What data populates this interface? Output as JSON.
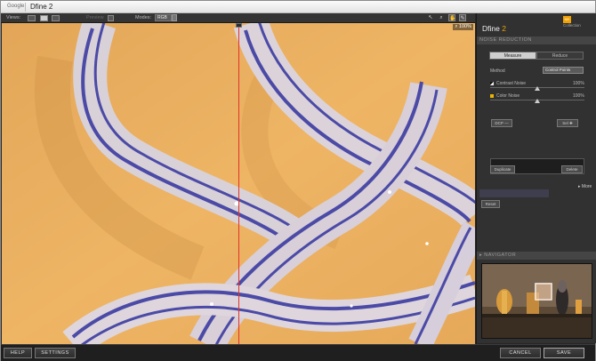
{
  "window": {
    "brand": "Google",
    "title": "Dfine 2"
  },
  "toolbar": {
    "views_label": "Views:",
    "preview_label": "Preview",
    "modes_label": "Modes:",
    "mode_value": "RGB",
    "zoom": "100%"
  },
  "panel": {
    "logo_mark": "NIK",
    "logo_text": "Collection",
    "product_name": "Dfine",
    "product_version": "2",
    "noise_reduction_header": "NOISE REDUCTION",
    "tabs": [
      {
        "label": "Measure"
      },
      {
        "label": "Reduce"
      }
    ],
    "method_label": "Method",
    "method_value": "Control Points",
    "contrast_noise_label": "Contrast Noise",
    "contrast_noise_value": "100%",
    "contrast_noise_level": 0.5,
    "color_noise_label": "Color Noise",
    "color_noise_value": "100%",
    "color_noise_level": 0.5,
    "cp_left_label": "DCP",
    "cp_right_label": "Sel",
    "duplicate_label": "Duplicate",
    "delete_label": "Delete",
    "more_label": "More",
    "reset_label": "Reset",
    "navigator_header": "NAVIGATOR"
  },
  "bottombar": {
    "help_label": "HELP",
    "settings_label": "SETTINGS",
    "cancel_label": "CANCEL",
    "save_label": "SAVE"
  },
  "colors": {
    "accent": "#f2a100",
    "split_line": "#e1342a",
    "canvas_background": "#e9ad5c",
    "glass_stripe": "#4b4aa6"
  },
  "icons": {
    "view_single": "single-view-icon",
    "view_split": "split-view-icon",
    "view_side": "side-by-side-view-icon",
    "pointer": "pointer-tool-icon",
    "zoom": "zoom-tool-icon",
    "hand": "hand-tool-icon",
    "dropper": "eyedropper-tool-icon"
  }
}
